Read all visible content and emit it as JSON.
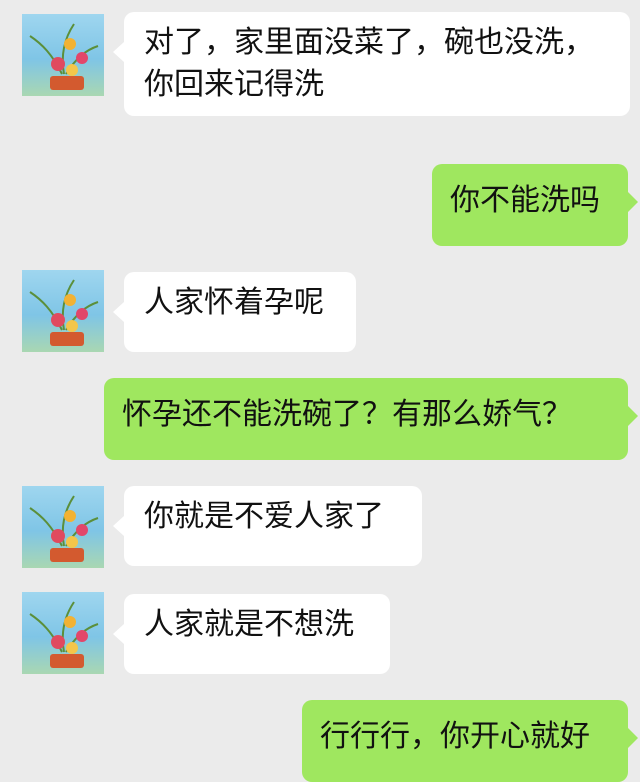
{
  "messages": [
    {
      "side": "incoming",
      "text": "对了，家里面没菜了，碗也没洗，你回来记得洗"
    },
    {
      "side": "outgoing",
      "text": "你不能洗吗"
    },
    {
      "side": "incoming",
      "text": "人家怀着孕呢"
    },
    {
      "side": "outgoing",
      "text": "怀孕还不能洗碗了？有那么娇气？"
    },
    {
      "side": "incoming",
      "text": "你就是不爱人家了"
    },
    {
      "side": "incoming",
      "text": "人家就是不想洗"
    },
    {
      "side": "outgoing",
      "text": "行行行，你开心就好"
    }
  ],
  "colors": {
    "background": "#ebebeb",
    "incoming_bubble": "#ffffff",
    "outgoing_bubble": "#9fe75f"
  },
  "icons": {
    "contact_avatar": "flower-arrangement-avatar-icon"
  }
}
